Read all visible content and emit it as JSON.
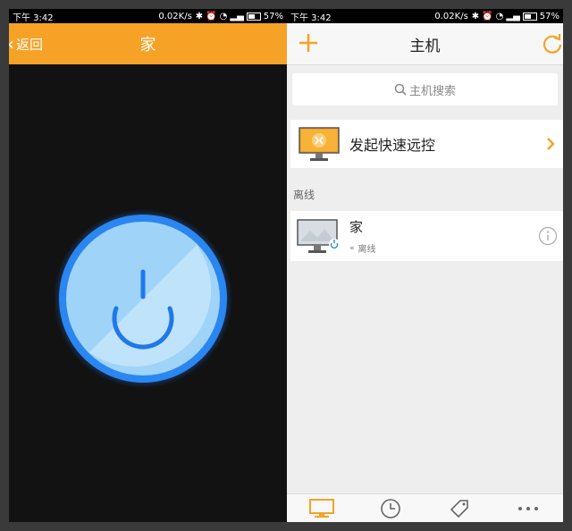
{
  "status_bar": {
    "time": "下午 3:42",
    "network_speed": "0.02K/s",
    "battery": "57%",
    "battery_level": 0.57
  },
  "left_screen": {
    "back_label": "返回",
    "title": "家",
    "power_icon": "power-icon",
    "accent_color": "#f5a227"
  },
  "right_screen": {
    "title": "主机",
    "search_placeholder": "主机搜索",
    "quick_remote_label": "发起快速远控",
    "section_offline": "离线",
    "hosts": [
      {
        "name": "家",
        "status": "离线"
      }
    ],
    "tabs": [
      {
        "icon": "monitor-icon",
        "active": true
      },
      {
        "icon": "clock-icon",
        "active": false
      },
      {
        "icon": "tag-icon",
        "active": false
      },
      {
        "icon": "more-icon",
        "active": false
      }
    ],
    "accent_color": "#f5a227"
  }
}
